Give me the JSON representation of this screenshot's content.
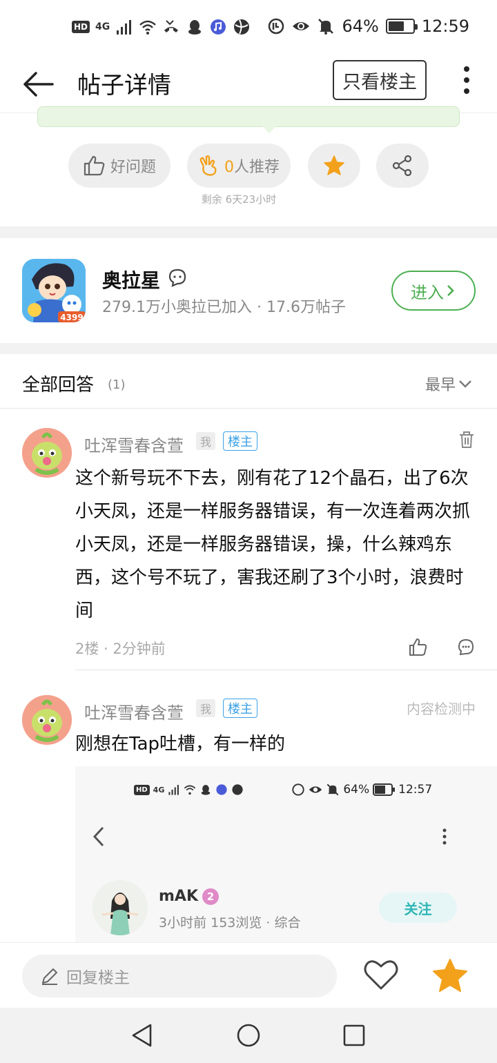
{
  "status_bar": {
    "hd": "HD",
    "network": "4G",
    "battery": "64%",
    "battery_level": 0.64,
    "time": "12:59"
  },
  "nav": {
    "title": "帖子详情",
    "only_host_label": "只看楼主"
  },
  "actions": {
    "good_question_label": "好问题",
    "recommend_count": "0",
    "recommend_label": "人推荐",
    "remaining": "剩余 6天23小时"
  },
  "forum": {
    "name": "奥拉星",
    "stats": "279.1万小奥拉已加入 · 17.6万帖子",
    "icon_badge": "4399",
    "enter_label": "进入"
  },
  "answers": {
    "title": "全部回答",
    "count": "(1)",
    "sort_label": "最早"
  },
  "replies": [
    {
      "user": "吐浑雪春含萱",
      "me_tag": "我",
      "host_tag": "楼主",
      "content": "这个新号玩不下去，刚有花了12个晶石，出了6次小天凤，还是一样服务器错误，有一次连着两次抓小天凤，还是一样服务器错误，操，什么辣鸡东西，这个号不玩了，害我还刷了3个小时，浪费时间",
      "meta": "2楼 · 2分钟前"
    },
    {
      "user": "吐浑雪春含萱",
      "me_tag": "我",
      "host_tag": "楼主",
      "status": "内容检测中",
      "content": "刚想在Tap吐槽，有一样的"
    }
  ],
  "embedded_screenshot": {
    "battery": "64%",
    "time": "12:57",
    "user": "mAK",
    "level": "2",
    "meta": "3小时前  153浏览 · 综合",
    "follow_label": "关注"
  },
  "reply_bar": {
    "placeholder": "回复楼主"
  },
  "colors": {
    "green": "#4caf50",
    "orange": "#f3a11b",
    "blue_tag": "#3aa1e6",
    "teal": "#2fb6b6"
  }
}
